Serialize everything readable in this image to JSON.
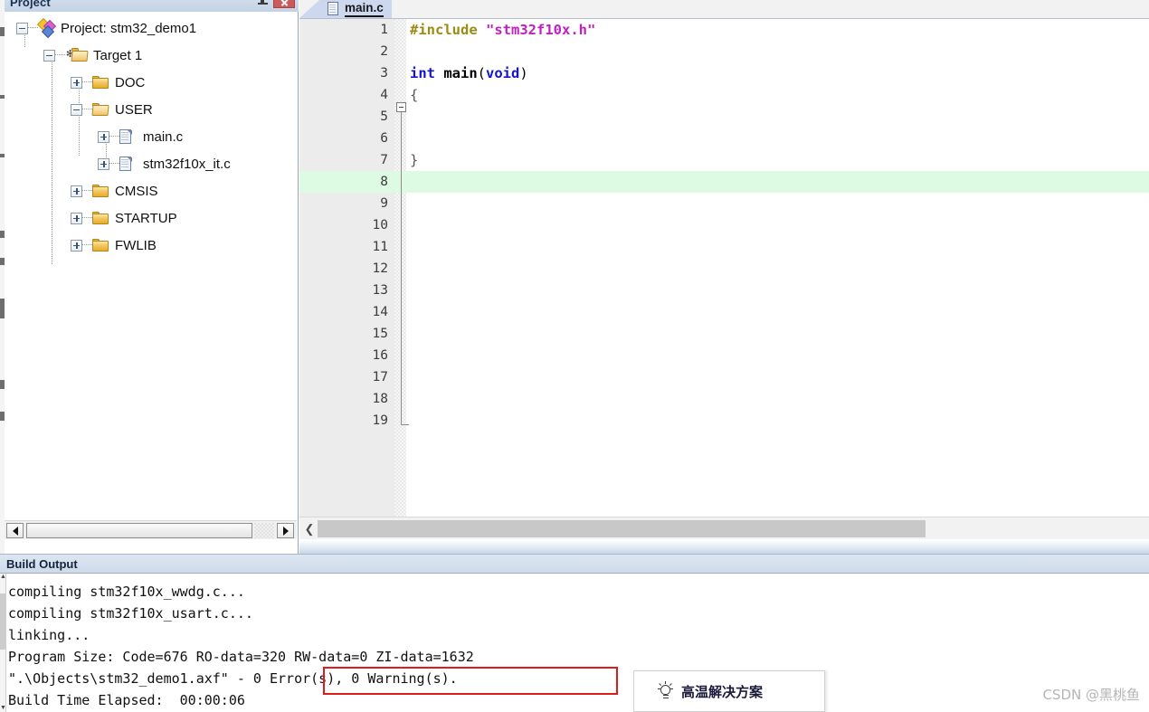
{
  "project_pane": {
    "title": "Project",
    "pin_icon": "pin-icon",
    "close_icon": "close-icon",
    "tree": [
      {
        "label": "Project: stm32_demo1",
        "icon": "project-icon",
        "expander": "minus",
        "depth": 0
      },
      {
        "label": "Target 1",
        "icon": "target-icon",
        "expander": "minus",
        "depth": 1
      },
      {
        "label": "DOC",
        "icon": "folder-closed-icon",
        "expander": "plus",
        "depth": 2
      },
      {
        "label": "USER",
        "icon": "folder-open-icon",
        "expander": "minus",
        "depth": 2
      },
      {
        "label": "main.c",
        "icon": "c-file-icon",
        "expander": "plus",
        "depth": 3
      },
      {
        "label": "stm32f10x_it.c",
        "icon": "c-file-icon",
        "expander": "plus",
        "depth": 3
      },
      {
        "label": "CMSIS",
        "icon": "folder-closed-icon",
        "expander": "plus",
        "depth": 2
      },
      {
        "label": "STARTUP",
        "icon": "folder-closed-icon",
        "expander": "plus",
        "depth": 2
      },
      {
        "label": "FWLIB",
        "icon": "folder-closed-icon",
        "expander": "plus",
        "depth": 2
      }
    ],
    "hscroll": {
      "left_arrow_icon": "arrow-left-icon",
      "right_arrow_icon": "arrow-right-icon"
    }
  },
  "editor": {
    "tab": {
      "label": "main.c",
      "icon": "c-file-icon"
    },
    "lines": [
      {
        "num": "1",
        "tokens": [
          {
            "t": "#include ",
            "c": "pre"
          },
          {
            "t": "\"stm32f10x.h\"",
            "c": "str"
          }
        ]
      },
      {
        "num": "2",
        "tokens": []
      },
      {
        "num": "3",
        "tokens": [
          {
            "t": "int ",
            "c": "kw"
          },
          {
            "t": "main",
            "c": "id"
          },
          {
            "t": "(",
            "c": "punc"
          },
          {
            "t": "void",
            "c": "kw"
          },
          {
            "t": ")",
            "c": "punc"
          }
        ]
      },
      {
        "num": "4",
        "tokens": [
          {
            "t": "{",
            "c": "brace"
          }
        ]
      },
      {
        "num": "5",
        "tokens": []
      },
      {
        "num": "6",
        "tokens": []
      },
      {
        "num": "7",
        "tokens": [
          {
            "t": "}",
            "c": "brace"
          }
        ]
      },
      {
        "num": "8",
        "tokens": [],
        "highlight": true
      },
      {
        "num": "9",
        "tokens": []
      },
      {
        "num": "10",
        "tokens": []
      },
      {
        "num": "11",
        "tokens": []
      },
      {
        "num": "12",
        "tokens": []
      },
      {
        "num": "13",
        "tokens": []
      },
      {
        "num": "14",
        "tokens": []
      },
      {
        "num": "15",
        "tokens": []
      },
      {
        "num": "16",
        "tokens": []
      },
      {
        "num": "17",
        "tokens": []
      },
      {
        "num": "18",
        "tokens": []
      },
      {
        "num": "19",
        "tokens": []
      }
    ],
    "fold_marker": "fold-collapse-icon",
    "hscroll": {
      "left_arrow_icon": "chevron-left-icon"
    }
  },
  "build_output": {
    "title": "Build Output",
    "lines": [
      "compiling stm32f10x_wwdg.c...",
      "compiling stm32f10x_usart.c...",
      "linking...",
      "Program Size: Code=676 RO-data=320 RW-data=0 ZI-data=1632",
      "\".\\Objects\\stm32_demo1.axf\" - 0 Error(s), 0 Warning(s).",
      "Build Time Elapsed:  00:00:06"
    ],
    "highlight_annotation": "0 Error(s), 0 Warning(s)."
  },
  "overlay": {
    "promo_text": "高温解决方案",
    "promo_icon": "lightbulb-icon",
    "watermark": "CSDN @黑桃鱼"
  },
  "colors": {
    "highlight_line": "#ddfbe3",
    "annotation_red": "#e01b1b",
    "tab_active": "#cdd8ef",
    "panel_header": "#cfdaea"
  }
}
